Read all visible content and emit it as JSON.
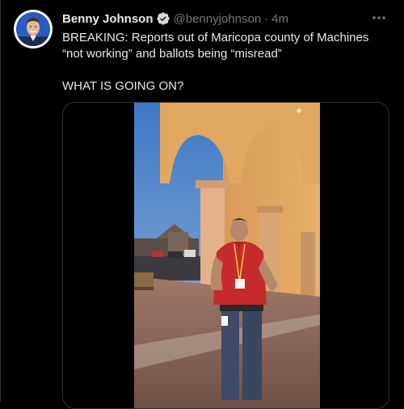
{
  "tweet": {
    "author": {
      "display_name": "Benny Johnson",
      "handle": "@bennyjohnson",
      "verified": true,
      "avatar": "profile-photo"
    },
    "separator": "·",
    "timestamp": "4m",
    "more_icon": "ellipsis-icon",
    "text_lines": [
      "BREAKING: Reports out of Maricopa county of Machines",
      "“not working” and ballots being “misread”"
    ],
    "text_followup": "WHAT IS GOING ON?",
    "media": {
      "type": "video",
      "content": "video-frame"
    }
  },
  "colors": {
    "background": "#000000",
    "primary_text": "#e7e9ea",
    "secondary_text": "#71767b",
    "verified_badge": "#d6d9db",
    "border": "#2f3336"
  }
}
